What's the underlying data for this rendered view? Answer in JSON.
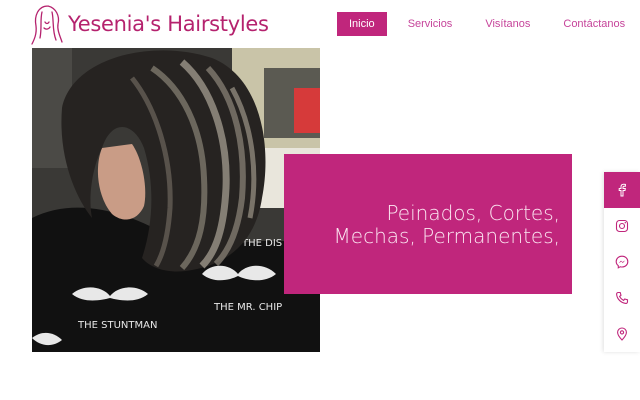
{
  "brand": {
    "name": "Yesenia's Hairstyles",
    "accent": "#c0267c"
  },
  "nav": {
    "items": [
      {
        "label": "Inicio",
        "active": true
      },
      {
        "label": "Servicios",
        "active": false
      },
      {
        "label": "Visítanos",
        "active": false
      },
      {
        "label": "Contáctanos",
        "active": false
      }
    ]
  },
  "hero": {
    "photo_text": [
      "THE STUNTMAN",
      "THE MR. CHIP",
      "THE DIS"
    ],
    "banner_lines": [
      "Peinados, Cortes,",
      "Mechas, Permanentes,"
    ]
  },
  "social": {
    "icons": [
      "facebook-icon",
      "instagram-icon",
      "messenger-icon",
      "phone-icon",
      "location-icon"
    ]
  }
}
